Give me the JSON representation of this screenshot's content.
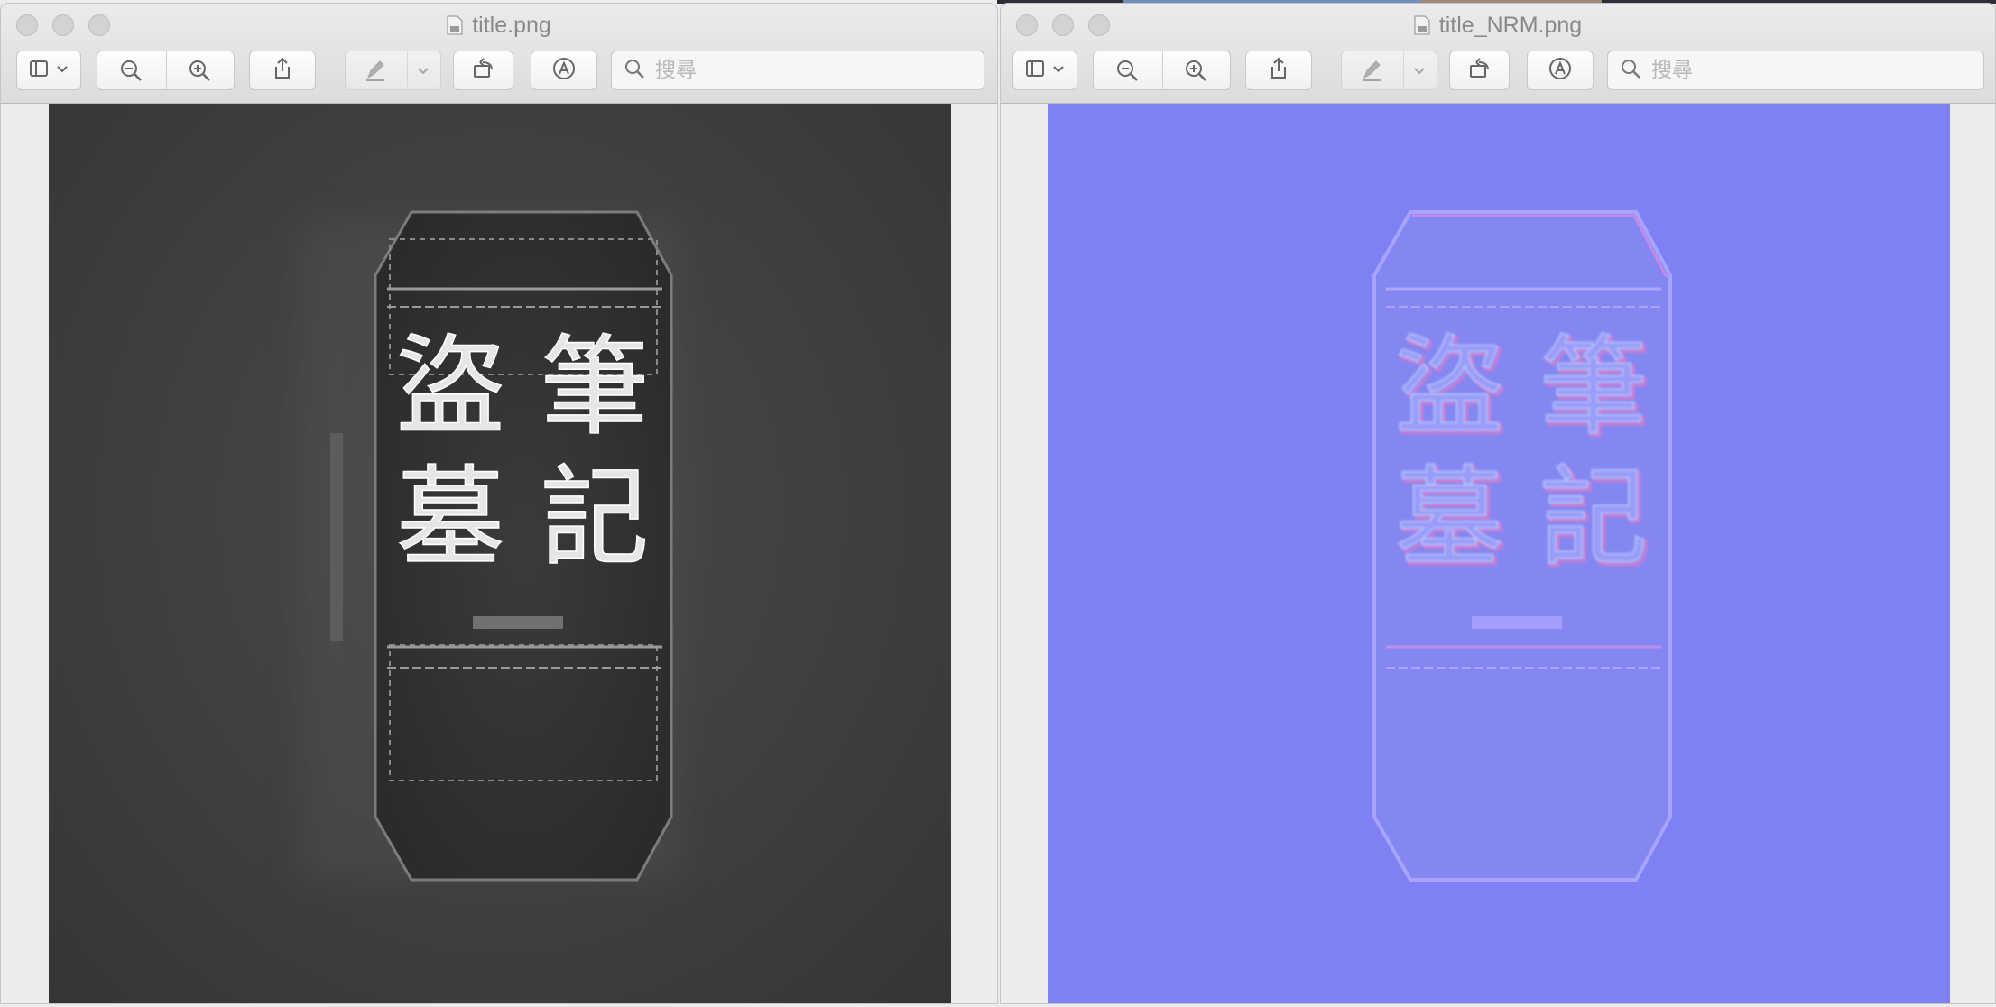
{
  "windows": [
    {
      "title": "title.png",
      "search_placeholder": "搜尋",
      "image_name": "title.png"
    },
    {
      "title": "title_NRM.png",
      "search_placeholder": "搜尋",
      "image_name": "title_NRM.png"
    }
  ],
  "emblem_text": [
    "盜",
    "墓",
    "筆",
    "記"
  ],
  "toolbar_icons": [
    "sidebar-toggle-icon",
    "zoom-out-icon",
    "zoom-in-icon",
    "share-icon",
    "markup-pen-icon",
    "rotate-icon",
    "annotate-icon",
    "search-icon"
  ],
  "colors": {
    "left_canvas": "#3f3f3e",
    "right_canvas": "#7e80f4"
  }
}
